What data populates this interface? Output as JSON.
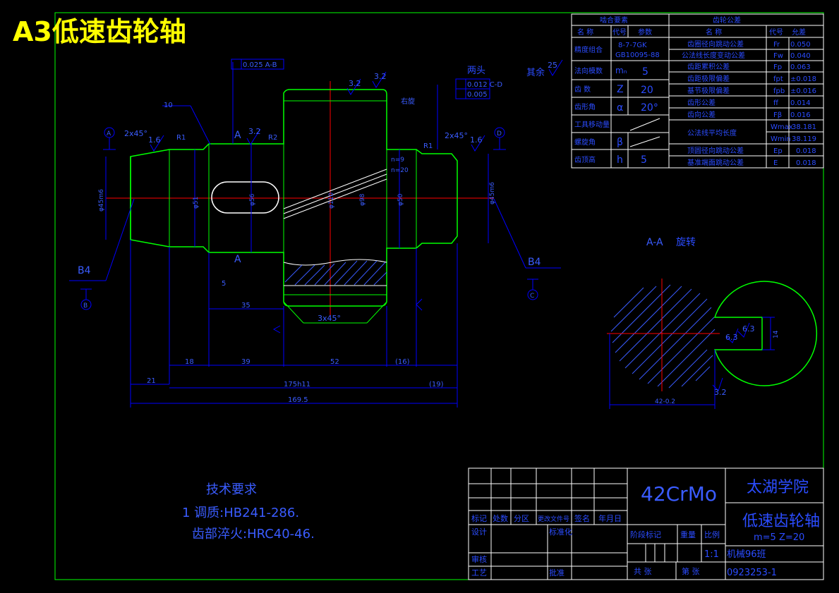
{
  "page_title": "A3低速齿轮轴",
  "colors": {
    "frame": "#00ff00",
    "dim": "#0000ff",
    "text_dim": "#3a5cff",
    "center": "#ff0000",
    "outline": "#00ff00",
    "white": "#ffffff",
    "title_yellow": "#ffff00",
    "table_text": "#2b4cff",
    "section": "#00ff66"
  },
  "mesh_table": {
    "header_left": "啮合要素",
    "header_right": "齿轮公差",
    "col_name": "名 称",
    "col_code": "代号",
    "col_param": "参数",
    "col_name2": "名 称",
    "col_code2": "代号",
    "col_val2": "允差",
    "rows_left": [
      {
        "name": "精度组合",
        "code": "8-7-7GK",
        "param": "GB10095-88"
      },
      {
        "name": "法向模数",
        "code": "mₙ",
        "param": "5"
      },
      {
        "name": "齿 数",
        "code": "Z",
        "param": "20"
      },
      {
        "name": "齿形角",
        "code": "α",
        "param": "20°"
      },
      {
        "name": "工具移动量",
        "code": "",
        "param": ""
      },
      {
        "name": "螺旋角",
        "code": "β",
        "param": ""
      },
      {
        "name": "齿顶高",
        "code": "h",
        "param": "5"
      }
    ],
    "rows_right": [
      {
        "name": "齿圈径向跳动公差",
        "code": "Fr",
        "val": "0.050"
      },
      {
        "name": "公法线长度变动公差",
        "code": "Fw",
        "val": "0.040"
      },
      {
        "name": "齿距累积公差",
        "code": "Fp",
        "val": "0.063"
      },
      {
        "name": "齿距极限偏差",
        "code": "fpt",
        "val": "±0.018"
      },
      {
        "name": "基节极限偏差",
        "code": "fpb",
        "val": "±0.016"
      },
      {
        "name": "齿形公差",
        "code": "ff",
        "val": "0.014"
      },
      {
        "name": "齿向公差",
        "code": "Fβ",
        "val": "0.016"
      },
      {
        "name": "公法线平均长度",
        "code": "Wmax",
        "val": "38.181"
      },
      {
        "name": "",
        "code": "Wmin",
        "val": "38.119"
      },
      {
        "name": "顶圆径向跳动公差",
        "code": "Ep",
        "val": "0.018"
      },
      {
        "name": "基准端面跳动公差",
        "code": "E",
        "val": "0.018"
      }
    ]
  },
  "drawing_labels": {
    "two_ends": "两头",
    "others": "其余",
    "others_rough": "25",
    "chamfer_left": "2x45°",
    "chamfer_right": "2x45°",
    "chamfer_bottom": "3x45°",
    "section_label_top": "A",
    "section_label_bottom": "A",
    "datum_a": "A",
    "datum_b": "B",
    "datum_c": "C",
    "datum_d": "D",
    "b4_left": "B4",
    "b4_right": "B4",
    "rough_32a": "3.2",
    "rough_32b": "3.2",
    "rough_32c": "3.2",
    "rough_16a": "1.6",
    "rough_16b": "1.6",
    "tol_top": "0.025 A-B",
    "tol_right1": "0.012 C-D",
    "tol_right2": "0.005",
    "dim_10": "10",
    "dim_35": "35",
    "dim_5": "5",
    "dim_21": "21",
    "dim_19": "(19)",
    "dim_18": "18",
    "dim_39": "39",
    "dim_52": "52",
    "dim_16": "(16)",
    "dim_175": "175h11",
    "dim_169": "169.5",
    "dim_r1a": "R1",
    "dim_r1b": "R1",
    "dim_r2": "R2",
    "dia_45_left": "φ45m6",
    "dia_45_right": "φ45m6",
    "dia_51": "φ51",
    "dia_50": "φ50",
    "dia_110": "φ110",
    "dia_98": "φ98",
    "dia_56": "φ56",
    "helix_label1": "n=9",
    "helix_label2": "n=20",
    "handed": "右旋"
  },
  "section": {
    "title": "A-A",
    "subtitle": "旋转",
    "dim_bottom": "42-0.2",
    "dim_side": "14",
    "rough_1": "6.3",
    "rough_2": "6.3",
    "rough_3": "3.2"
  },
  "tech_req": {
    "title": "技术要求",
    "line1": "1 调质:HB241-286.",
    "line2": "齿部淬火:HRC40-46."
  },
  "title_block": {
    "material": "42CrMo",
    "school": "太湖学院",
    "part_name": "低速齿轮轴",
    "part_spec": "m=5  Z=20",
    "scale_label": "比例",
    "scale": "1:1",
    "weight_label": "重量",
    "stage_label": "阶段标记",
    "class_name": "机械96班",
    "drawing_no": "0923253-1",
    "total_label": "共  张",
    "sheet_label": "第  张",
    "h_mark": "标记",
    "h_count": "处数",
    "h_zone": "分区",
    "h_doc": "更改文件号",
    "h_sign": "签名",
    "h_date": "年月日",
    "design": "设计",
    "standard": "标准化",
    "review": "审核",
    "process": "工艺",
    "approve": "批准"
  }
}
